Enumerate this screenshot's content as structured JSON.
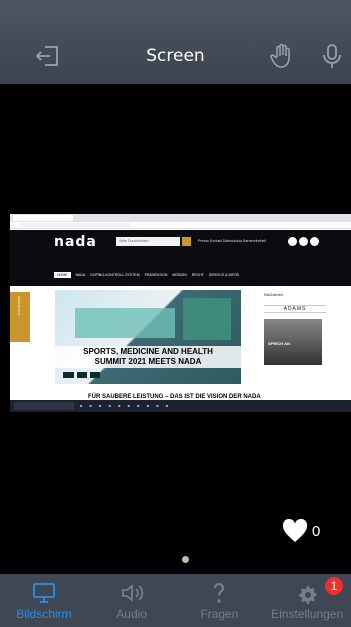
{
  "header": {
    "title": "Screen"
  },
  "shared_screen": {
    "search_placeholder": "Seite Durchsuchen",
    "top_nav": "Presse  Kontakt  Datenschutz  Barrierefreiheit",
    "main_nav": [
      "HOME",
      "NADA",
      "DOPING-KONTROLL-SYSTEM",
      "PRÄVENTION",
      "MEDIZIN",
      "RECHT",
      "SERVICE & INFOS"
    ],
    "hero_caption_line1": "SPORTS, MEDICINE AND HEALTH",
    "hero_caption_line2": "SUMMIT 2021 MEETS NADA",
    "promo_label": "SPRICH AN",
    "partner_adams": "ADAMS",
    "vision_heading": "FÜR SAUBERE LEISTUNG – DAS IST DIE VISION DER NADA",
    "sidebar_tag": "ANTI-DOPING"
  },
  "reactions": {
    "like_count": "0"
  },
  "tabs": [
    {
      "label": "Bildschirm",
      "active": true,
      "icon": "monitor-icon"
    },
    {
      "label": "Audio",
      "active": false,
      "icon": "speaker-icon"
    },
    {
      "label": "Fragen",
      "active": false,
      "icon": "question-icon"
    },
    {
      "label": "Einstellungen",
      "active": false,
      "icon": "gear-icon",
      "badge": "1"
    }
  ],
  "colors": {
    "accent": "#2a8fe6",
    "badge": "#e8322a",
    "bar": "#3f4654"
  }
}
